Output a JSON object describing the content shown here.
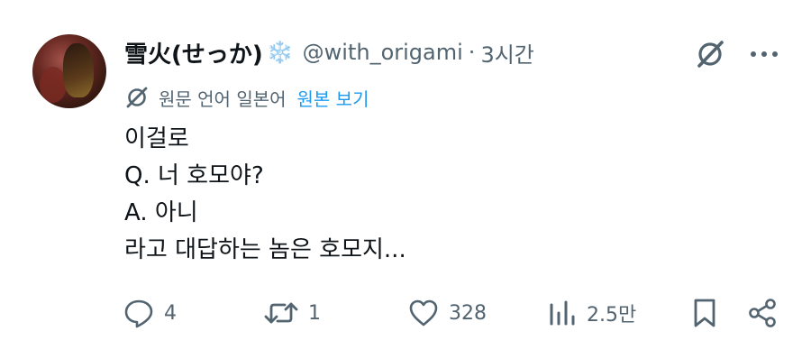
{
  "tweet": {
    "display_name": "雪火(せっか)",
    "name_emoji": "❄️",
    "handle": "@with_origami",
    "separator": "·",
    "time_ago": "3시간",
    "translation_note": "원문 언어 일본어",
    "show_original_label": "원본 보기",
    "lines": [
      "이걸로",
      "Q. 너 호모야?",
      "A. 아니",
      "라고 대답하는 놈은 호모지..."
    ]
  },
  "actions": {
    "reply_count": "4",
    "retweet_count": "1",
    "like_count": "328",
    "views_count": "2.5만"
  },
  "icons": {
    "grok": "grok-icon",
    "more": "more-icon",
    "translate": "translate-icon",
    "reply": "reply-icon",
    "retweet": "retweet-icon",
    "like": "heart-icon",
    "views": "views-icon",
    "bookmark": "bookmark-icon",
    "share": "share-icon"
  },
  "colors": {
    "text": "#0f1419",
    "muted": "#536471",
    "link": "#1d9bf0",
    "snowflake": "#74c1ea"
  }
}
